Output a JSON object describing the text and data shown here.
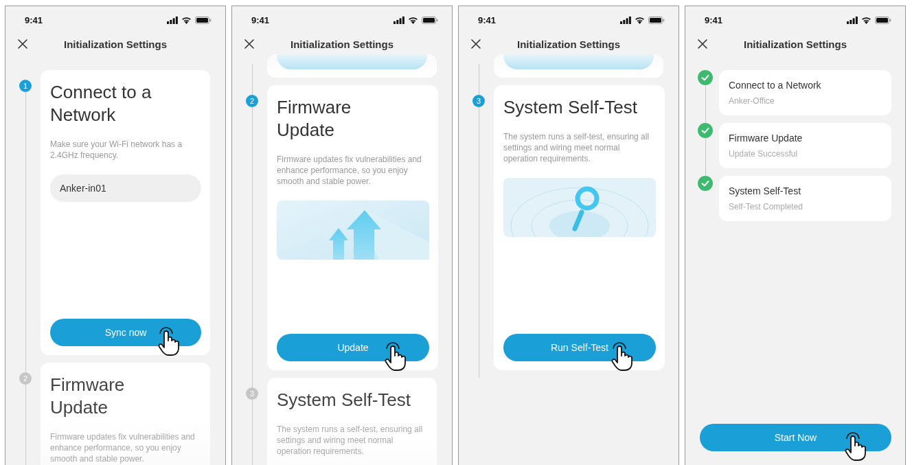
{
  "screens": [
    {
      "status_time": "9:41",
      "title": "Initialization Settings",
      "kind": "steps",
      "steps": [
        {
          "kind": "active",
          "number": "1",
          "title": "Connect to a Network",
          "description": "Make sure your Wi-Fi network has a 2.4GHz frequency.",
          "field_value": "Anker-in01",
          "button": "Sync now"
        },
        {
          "kind": "upcoming",
          "number": "2",
          "title": "Firmware Update",
          "description": "Firmware updates fix vulnerabilities and enhance performance, so you enjoy smooth and stable power."
        }
      ]
    },
    {
      "status_time": "9:41",
      "title": "Initialization Settings",
      "kind": "steps",
      "steps": [
        {
          "kind": "passed"
        },
        {
          "kind": "active",
          "number": "2",
          "title": "Firmware Update",
          "description": "Firmware updates fix vulnerabilities and enhance performance, so you enjoy smooth and stable power.",
          "button": "Update",
          "illustration": {
            "kind": "arrows"
          }
        },
        {
          "kind": "upcoming",
          "number": "3",
          "title": "System Self-Test",
          "description": "The system runs a self-test, ensuring all settings and wiring meet normal operation requirements."
        }
      ]
    },
    {
      "status_time": "9:41",
      "title": "Initialization Settings",
      "kind": "steps",
      "steps": [
        {
          "kind": "passed"
        },
        {
          "kind": "active",
          "number": "3",
          "title": "System Self-Test",
          "description": "The system runs a self-test, ensuring all settings and wiring meet normal operation requirements.",
          "button": "Run Self-Test",
          "illustration": {
            "kind": "magnifier"
          }
        }
      ]
    },
    {
      "status_time": "9:41",
      "title": "Initialization Settings",
      "kind": "summary",
      "items": [
        {
          "title": "Connect to a Network",
          "subtitle": "Anker-Office",
          "done": true
        },
        {
          "title": "Firmware Update",
          "subtitle": "Update Successful",
          "done": true
        },
        {
          "title": "System Self-Test",
          "subtitle": "Self-Test Completed",
          "done": true
        }
      ],
      "button": "Start Now"
    }
  ]
}
